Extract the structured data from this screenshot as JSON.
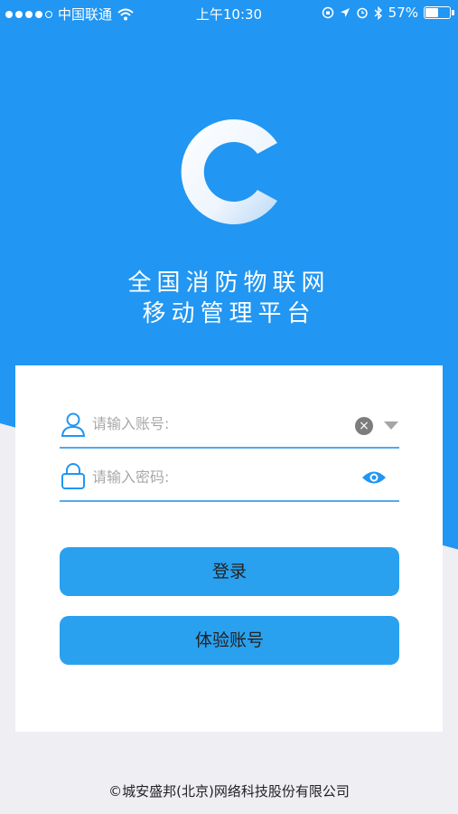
{
  "status_bar": {
    "carrier": "中国联通",
    "time": "上午10:30",
    "battery_percent": "57%",
    "battery_level": 0.57,
    "signal_bars_filled": 4,
    "signal_bars_total": 5,
    "icons": [
      "wifi-icon",
      "orientation-lock-icon",
      "location-arrow-icon",
      "alarm-icon",
      "bluetooth-icon",
      "battery-icon"
    ]
  },
  "app": {
    "title_line1": "全国消防物联网",
    "title_line2": "移动管理平台",
    "logo_icon": "c-logo-icon"
  },
  "login": {
    "account_placeholder": "请输入账号:",
    "account_value": "",
    "password_placeholder": "请输入密码:",
    "password_value": "",
    "login_label": "登录",
    "trial_label": "体验账号"
  },
  "footer": {
    "copyright": "©城安盛邦(北京)网络科技股份有限公司"
  },
  "colors": {
    "primary_blue": "#2196f2",
    "button_blue": "#2aa1ef",
    "line_blue": "#56a8ee",
    "background_gray": "#eeeef3"
  }
}
